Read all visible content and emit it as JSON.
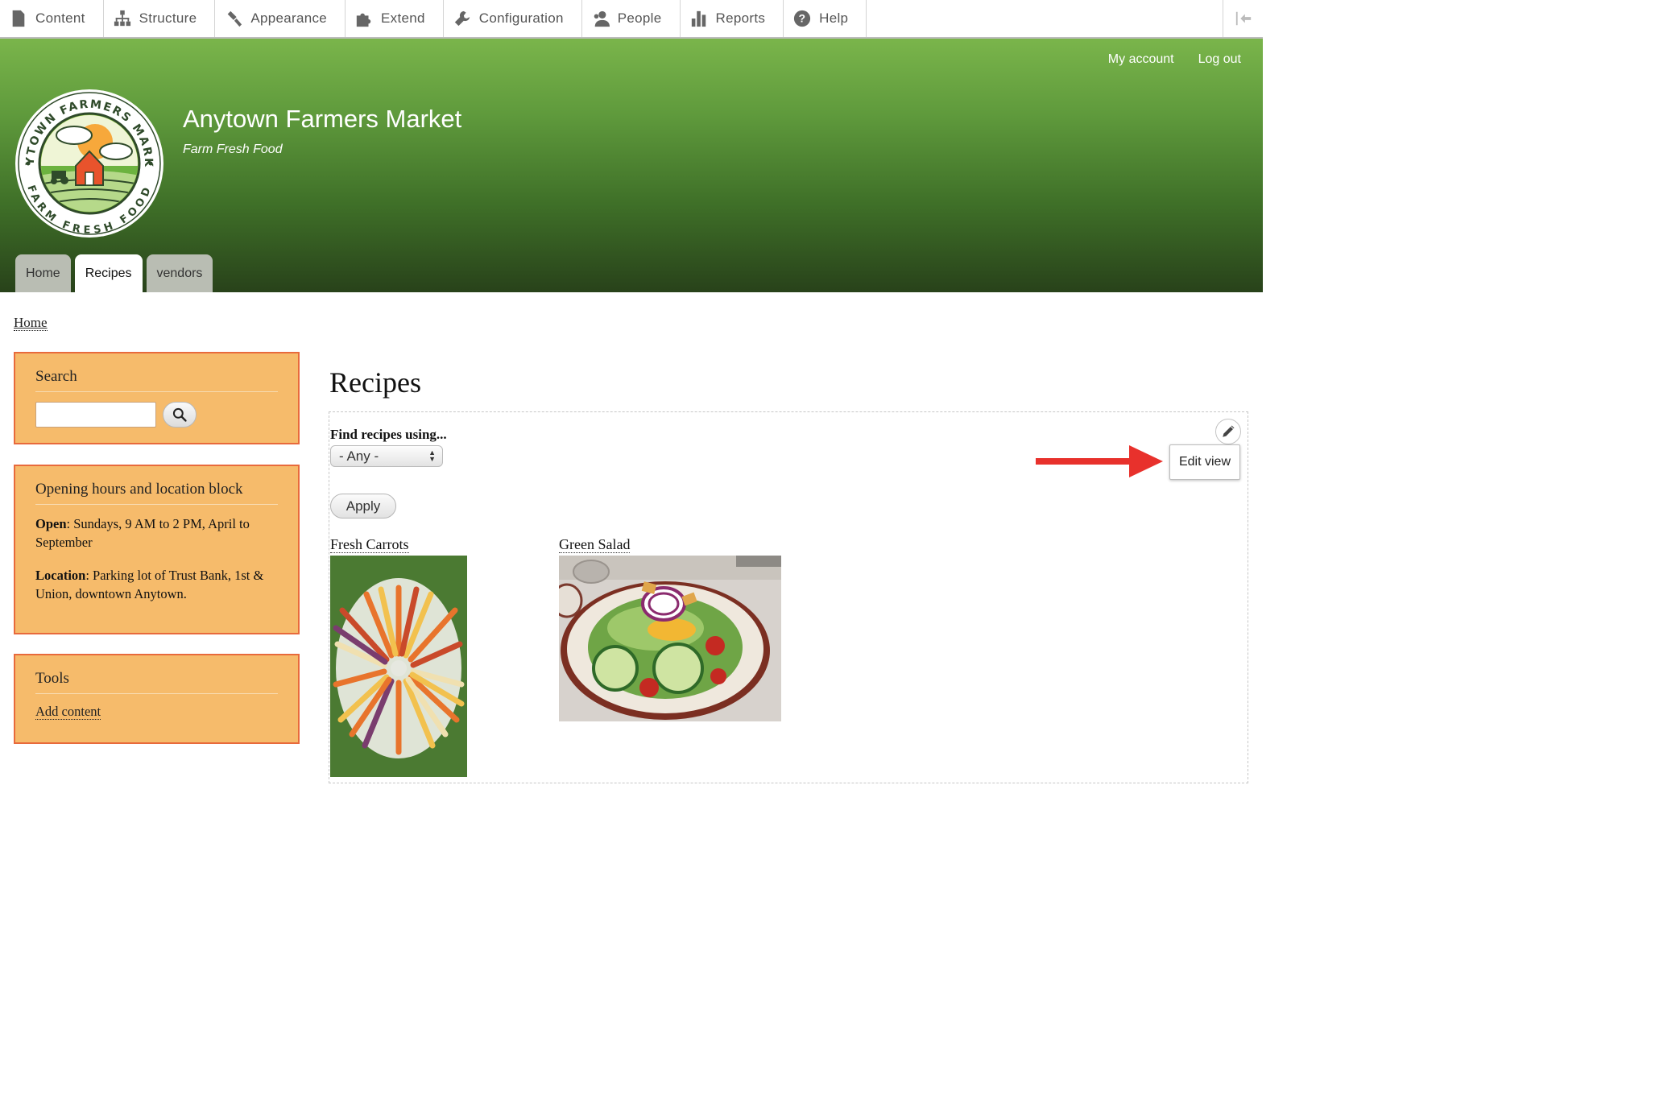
{
  "toolbar": {
    "items": [
      {
        "label": "Content",
        "icon": "file-icon"
      },
      {
        "label": "Structure",
        "icon": "sitemap-icon"
      },
      {
        "label": "Appearance",
        "icon": "paint-icon"
      },
      {
        "label": "Extend",
        "icon": "puzzle-icon"
      },
      {
        "label": "Configuration",
        "icon": "wrench-icon"
      },
      {
        "label": "People",
        "icon": "people-icon"
      },
      {
        "label": "Reports",
        "icon": "bar-chart-icon"
      },
      {
        "label": "Help",
        "icon": "help-icon"
      }
    ],
    "collapse_icon": "collapse-sidebar-icon"
  },
  "header": {
    "user_menu": {
      "my_account": "My account",
      "logout": "Log out"
    },
    "site_name": "Anytown Farmers Market",
    "slogan": "Farm Fresh Food",
    "logo": {
      "top_text": "ANYTOWN FARMERS MARKET",
      "bottom_text": "FARM FRESH FOOD"
    },
    "tabs": [
      {
        "label": "Home",
        "active": false
      },
      {
        "label": "Recipes",
        "active": true
      },
      {
        "label": "vendors",
        "active": false
      }
    ],
    "gradient": [
      "#7ab54b",
      "#28421a"
    ]
  },
  "breadcrumb": {
    "home": "Home"
  },
  "sidebar": {
    "search": {
      "title": "Search",
      "placeholder": "",
      "button_icon": "search-icon"
    },
    "hours": {
      "title": "Opening hours and location block",
      "open_label": "Open",
      "open_text": ": Sundays, 9 AM to 2 PM, April to September",
      "location_label": "Location",
      "location_text": ": Parking lot of Trust Bank, 1st & Union, downtown Anytown."
    },
    "tools": {
      "title": "Tools",
      "add_content": "Add content"
    },
    "block_color": "#f6bb6b",
    "block_border": "#e86a3c"
  },
  "main": {
    "title": "Recipes",
    "filter": {
      "label": "Find recipes using...",
      "selected": "- Any -"
    },
    "apply": "Apply",
    "edit_view": "Edit view",
    "recipes": [
      {
        "title": "Fresh Carrots"
      },
      {
        "title": "Green Salad"
      }
    ]
  },
  "annotation_color": "#e8312c"
}
